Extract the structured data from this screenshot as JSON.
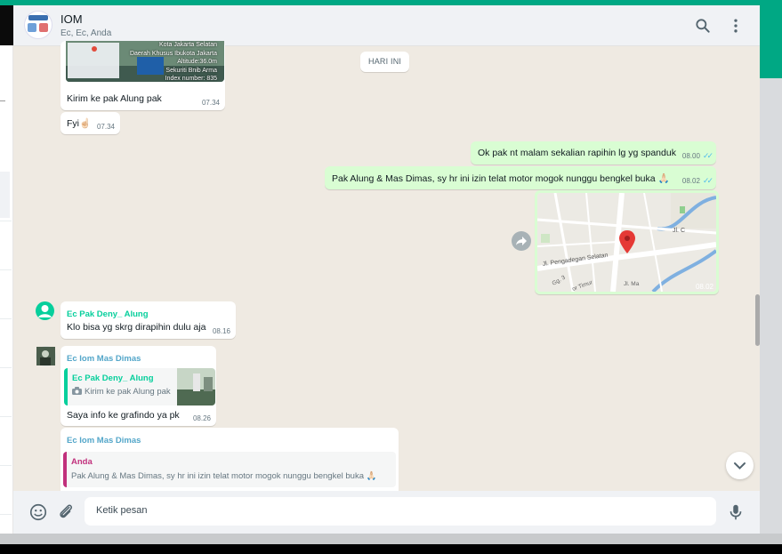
{
  "header": {
    "group_name": "IOM",
    "members": "Ec, Ec, Anda"
  },
  "date_divider": "HARI INI",
  "messages": [
    {
      "photo_caption": [
        "Kota Jakarta Selatan",
        "Daerah Khusus Ibukota Jakarta",
        "Altitude:36.0m",
        "Sekuriti Bnib Arma",
        "Index number: 835"
      ],
      "text": "Kirim ke pak Alung pak",
      "time": "07.34"
    },
    {
      "text": "Fyi☝🏻",
      "time": "07.34"
    },
    {
      "text": "Ok pak nt malam sekalian rapihin lg yg spanduk",
      "time": "08.00"
    },
    {
      "text": "Pak Alung & Mas Dimas, sy hr ini izin telat motor mogok nunggu bengkel buka 🙏🏻",
      "time": "08.02"
    },
    {
      "map_labels": [
        "Jl. C",
        "Jl. Pengadegan Selatan",
        "Gg. 3",
        "Jl. Ma",
        "or Timur"
      ],
      "time": "08.02"
    },
    {
      "sender": "Ec Pak Deny_ Alung",
      "text": "Klo bisa yg skrg dirapihin dulu aja",
      "time": "08.16"
    },
    {
      "sender": "Ec Iom Mas Dimas",
      "quote_sender": "Ec Pak Deny_ Alung",
      "quote_text": "Kirim ke pak Alung pak",
      "text": "Saya info ke grafindo ya pk",
      "time": "08.26"
    },
    {
      "sender": "Ec Iom Mas Dimas",
      "quote_sender": "Anda",
      "quote_text": "Pak Alung & Mas Dimas, sy hr ini izin telat motor mogok nunggu bengkel buka 🙏🏻"
    }
  ],
  "composer": {
    "placeholder": "Ketik pesan"
  },
  "colors": {
    "accent": "#00a884",
    "outgoing_bubble": "#d9fdd3",
    "chat_background": "#efeae2",
    "sender_green": "#06cf9c",
    "sender_blue": "#53a6c9",
    "sender_pink": "#c1307c",
    "read_tick": "#53bdeb"
  },
  "icons": [
    "search-icon",
    "menu-icon",
    "emoji-icon",
    "attach-icon",
    "mic-icon",
    "forward-icon",
    "chevron-down-icon",
    "camera-icon",
    "map-pin-icon",
    "default-avatar-icon"
  ]
}
